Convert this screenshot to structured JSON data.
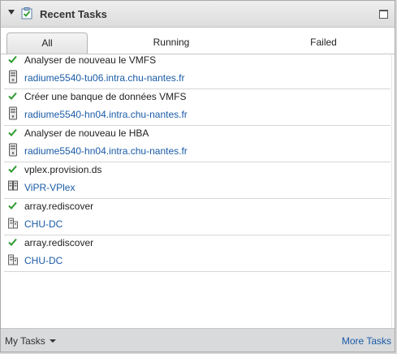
{
  "header": {
    "title": "Recent Tasks",
    "icon": "tasks-clipboard-icon"
  },
  "tabs": [
    {
      "label": "All",
      "active": true
    },
    {
      "label": "Running",
      "active": false
    },
    {
      "label": "Failed",
      "active": false
    }
  ],
  "tasks": [
    {
      "name": "Analyser de nouveau le VMFS",
      "status_icon": "check-icon",
      "object_icon": "host-icon",
      "object": "radiume5540-tu06.intra.chu-nantes.fr"
    },
    {
      "name": "Créer une banque de données VMFS",
      "status_icon": "check-icon",
      "object_icon": "host-icon",
      "object": "radiume5540-hn04.intra.chu-nantes.fr"
    },
    {
      "name": "Analyser de nouveau le HBA",
      "status_icon": "check-icon",
      "object_icon": "host-icon",
      "object": "radiume5540-hn04.intra.chu-nantes.fr"
    },
    {
      "name": "vplex.provision.ds",
      "status_icon": "check-icon",
      "object_icon": "storage-cluster-icon",
      "object": "ViPR-VPlex"
    },
    {
      "name": "array.rediscover",
      "status_icon": "check-icon",
      "object_icon": "datacenter-icon",
      "object": "CHU-DC"
    },
    {
      "name": "array.rediscover",
      "status_icon": "check-icon",
      "object_icon": "datacenter-icon",
      "object": "CHU-DC"
    }
  ],
  "footer": {
    "my_tasks_label": "My Tasks",
    "more_tasks_label": "More Tasks"
  },
  "colors": {
    "link": "#1a5ba6",
    "success": "#2e9a2e"
  }
}
